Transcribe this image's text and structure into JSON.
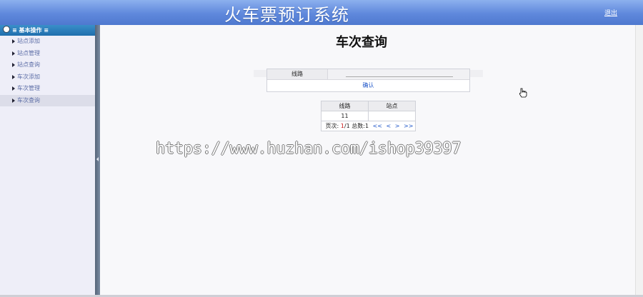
{
  "header": {
    "title": "火车票预订系统",
    "logout_label": "退出"
  },
  "sidebar": {
    "heading": "≡ 基本操作 ≡",
    "items": [
      {
        "label": "站点添加"
      },
      {
        "label": "站点管理"
      },
      {
        "label": "站点查询"
      },
      {
        "label": "车次添加"
      },
      {
        "label": "车次管理"
      },
      {
        "label": "车次查询",
        "active": true
      }
    ]
  },
  "main": {
    "title": "车次查询",
    "form": {
      "route_label": "线路",
      "route_value": "",
      "confirm_label": "确认"
    },
    "results": {
      "columns": [
        "线路",
        "站点"
      ],
      "rows": [
        [
          "11",
          ""
        ]
      ],
      "pager": {
        "page_label": "页次:",
        "current_page": "1",
        "total_pages": "/1",
        "total_label": "总数:",
        "total_count": "1",
        "first": "<<",
        "prev": "<",
        "next": ">",
        "last": ">>"
      }
    }
  },
  "watermark": "https://www.huzhan.com/ishop39397",
  "icons": [
    "menu-bullet-icon",
    "arrow-right-icon",
    "collapse-arrow-icon",
    "hand-cursor-icon"
  ],
  "colors": {
    "header_blue": "#5f88dc",
    "menu_head_blue": "#1f6fad",
    "link_blue": "#1f56c9",
    "pager_red": "#c81818"
  }
}
